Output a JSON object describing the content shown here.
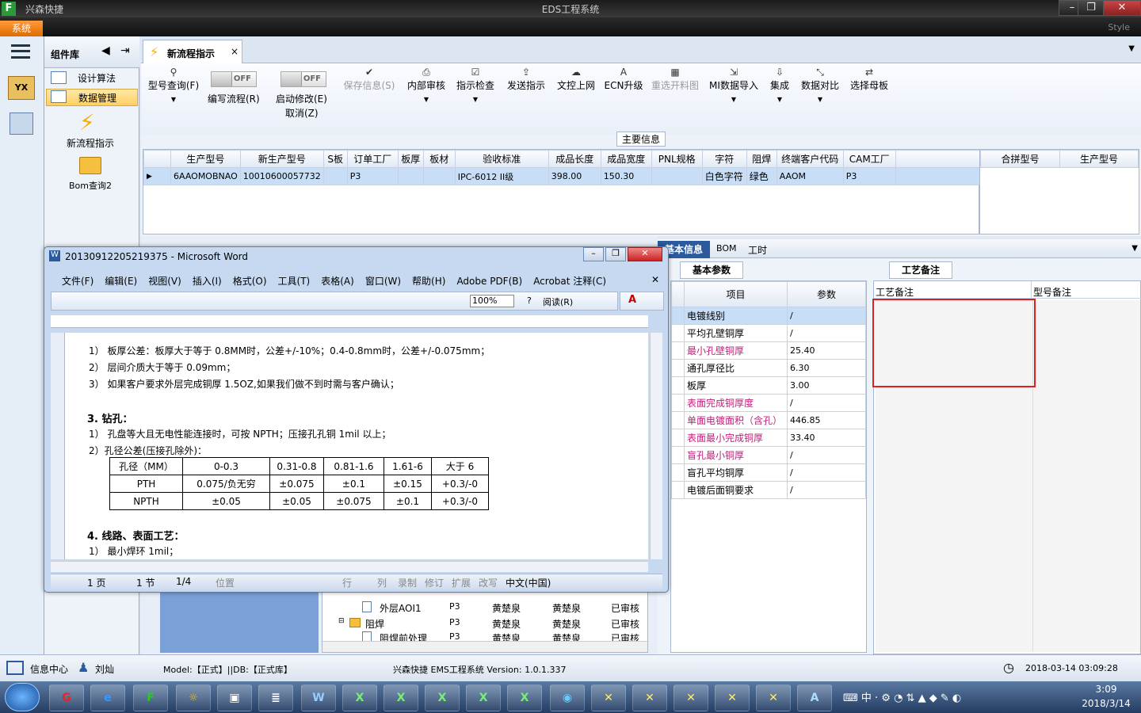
{
  "window": {
    "title": "EDS工程系统",
    "app_name": "兴森快捷",
    "system_menu": "系统",
    "style_label": "Style"
  },
  "nav": {
    "header": "组件库",
    "items": [
      {
        "label": "设计算法"
      },
      {
        "label": "数据管理"
      }
    ],
    "tools": [
      {
        "label": "新流程指示"
      },
      {
        "label": "Bom查询2"
      }
    ]
  },
  "tab": {
    "label": "新流程指示"
  },
  "toolbar": {
    "query": "型号查询(F)",
    "edit_flow": "编写流程(R)",
    "modify": "启动修改(E)",
    "cancel": "取消(Z)",
    "toggle_off": "OFF",
    "items": [
      "保存信息(S)",
      "内部审核",
      "指示检查",
      "发送指示",
      "文控上网",
      "ECN升级",
      "重选开料图",
      "MI数据导入",
      "集成",
      "数据对比",
      "选择母板"
    ]
  },
  "main_info": {
    "label": "主要信息",
    "headers": [
      "生产型号",
      "新生产型号",
      "S板",
      "订单工厂",
      "板厚",
      "板材",
      "验收标准",
      "成品长度",
      "成品宽度",
      "PNL规格",
      "字符",
      "阻焊",
      "终端客户代码",
      "CAM工厂"
    ],
    "row": [
      "6AAOMOBNAO",
      "10010600057732",
      "",
      "P3",
      "",
      "",
      "IPC-6012 II级",
      "398.00",
      "150.30",
      "",
      "白色字符",
      "绿色",
      "AAOM",
      "P3"
    ],
    "side_headers": [
      "合拼型号",
      "生产型号"
    ]
  },
  "right": {
    "tabs": [
      "基本信息",
      "BOM",
      "工时"
    ],
    "params_tab": "基本参数",
    "params_headers": [
      "项目",
      "参数"
    ],
    "params": [
      {
        "k": "电镀线别",
        "v": "/"
      },
      {
        "k": "平均孔壁铜厚",
        "v": "/"
      },
      {
        "k": "最小孔壁铜厚",
        "v": "25.40"
      },
      {
        "k": "通孔厚径比",
        "v": "6.30"
      },
      {
        "k": "板厚",
        "v": "3.00"
      },
      {
        "k": "表面完成铜厚度",
        "v": "/"
      },
      {
        "k": "单面电镀面积（含孔）",
        "v": "446.85"
      },
      {
        "k": "表面最小完成铜厚",
        "v": "33.40"
      },
      {
        "k": "盲孔最小铜厚",
        "v": "/"
      },
      {
        "k": "盲孔平均铜厚",
        "v": "/"
      },
      {
        "k": "电镀后面铜要求",
        "v": "/"
      }
    ],
    "notes_tab": "工艺备注",
    "notes_headers": [
      "工艺备注",
      "型号备注"
    ]
  },
  "tree": {
    "rows": [
      {
        "name": "外层AOI1",
        "f": "P3",
        "a": "黄楚泉",
        "b": "黄楚泉",
        "s": "已审核"
      },
      {
        "name": "阻焊",
        "f": "P3",
        "a": "黄楚泉",
        "b": "黄楚泉",
        "s": "已审核"
      },
      {
        "name": "阻焊前处理",
        "f": "P3",
        "a": "黄楚泉",
        "b": "黄楚泉",
        "s": "已审核"
      }
    ]
  },
  "status": {
    "info_center": "信息中心",
    "user": "刘灿",
    "model": "Model:【正式】||DB:【正式库】",
    "version": "兴森快捷 EMS工程系统 Version: 1.0.1.337",
    "datetime": "2018-03-14 03:09:28"
  },
  "word": {
    "title": "20130912205219375 - Microsoft Word",
    "menu": [
      "文件(F)",
      "编辑(E)",
      "视图(V)",
      "插入(I)",
      "格式(O)",
      "工具(T)",
      "表格(A)",
      "窗口(W)",
      "帮助(H)",
      "Adobe PDF(B)",
      "Acrobat 注释(C)"
    ],
    "zoom": "100%",
    "read": "阅读(R)",
    "lines": [
      "1） 板厚公差：板厚大于等于 0.8MM时，公差+/-10%；0.4-0.8mm时，公差+/-0.075mm；",
      "2） 层间介质大于等于 0.09mm；",
      "3） 如果客户要求外层完成铜厚 1.5OZ,如果我们做不到时需与客户确认；"
    ],
    "sec3": "3.  钻孔：",
    "drill1": "1） 孔盘等大且无电性能连接时，可按 NPTH；压接孔孔铜 1mil 以上；",
    "drill2": "2）孔径公差(压接孔除外)：",
    "table": [
      [
        "孔径（MM）",
        "0-0.3",
        "0.31-0.8",
        "0.81-1.6",
        "1.61-6",
        "大于 6"
      ],
      [
        "PTH",
        "0.075/负无穷",
        "±0.075",
        "±0.1",
        "±0.15",
        "+0.3/-0"
      ],
      [
        "NPTH",
        "±0.05",
        "±0.05",
        "±0.075",
        "±0.1",
        "+0.3/-0"
      ]
    ],
    "sec4": "4.  线路、表面工艺：",
    "line4": "1） 最小焊环 1mil；",
    "statusbar": {
      "page": "1 页",
      "section": "1 节",
      "pos": "1/4",
      "at": "位置",
      "ln": "行",
      "col": "列",
      "rec": "录制",
      "trk": "修订",
      "ext": "扩展",
      "ovr": "改写",
      "lang": "中文(中国)"
    }
  },
  "clock": {
    "time": "3:09",
    "date": "2018/3/14"
  }
}
